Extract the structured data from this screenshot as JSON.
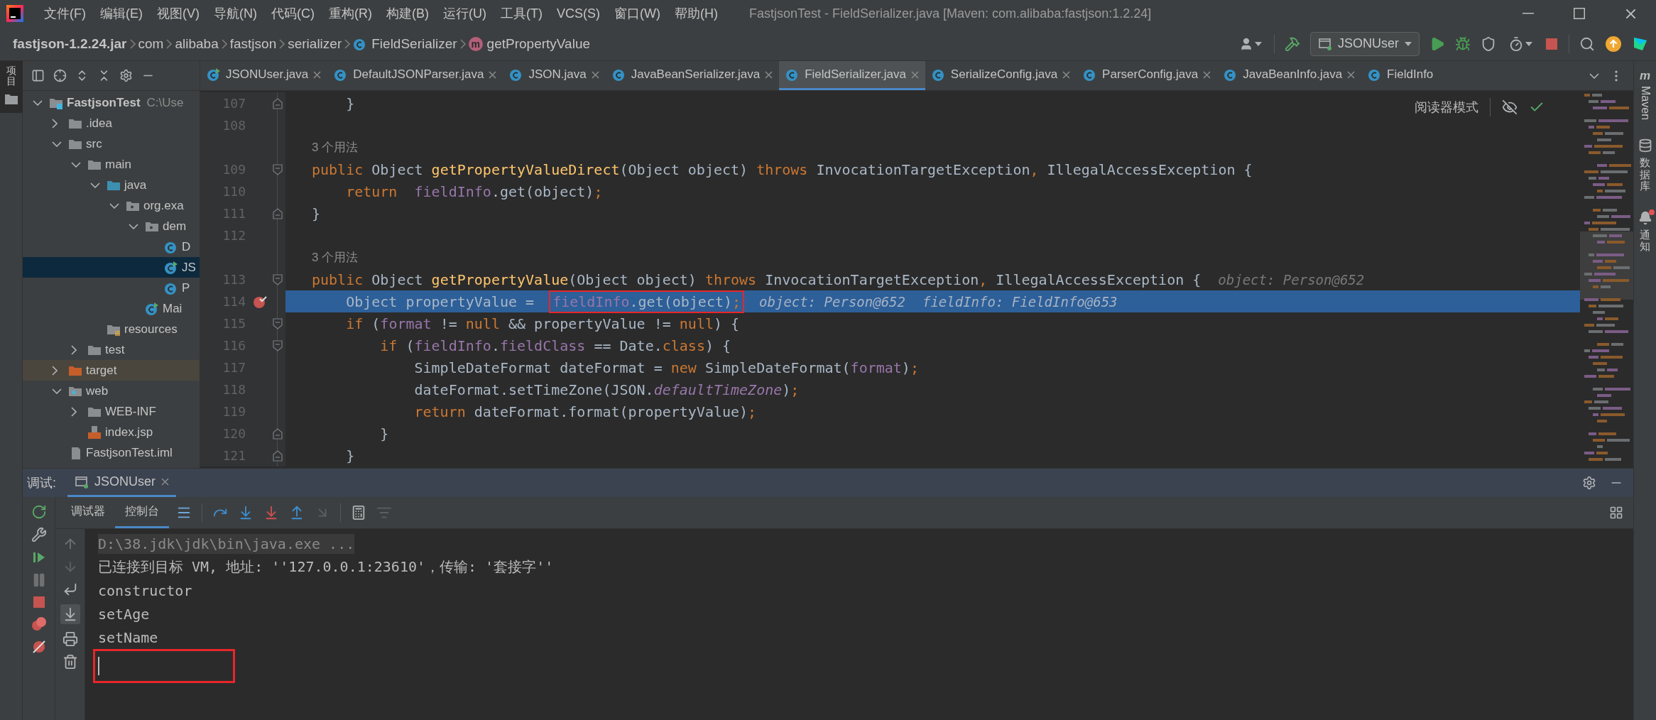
{
  "window": {
    "title": "FastjsonTest - FieldSerializer.java [Maven: com.alibaba:fastjson:1.2.24]"
  },
  "menu": [
    "文件(F)",
    "编辑(E)",
    "视图(V)",
    "导航(N)",
    "代码(C)",
    "重构(R)",
    "构建(B)",
    "运行(U)",
    "工具(T)",
    "VCS(S)",
    "窗口(W)",
    "帮助(H)"
  ],
  "breadcrumbs": [
    {
      "kind": "jar",
      "label": "fastjson-1.2.24.jar"
    },
    {
      "kind": "package",
      "label": "com"
    },
    {
      "kind": "package",
      "label": "alibaba"
    },
    {
      "kind": "package",
      "label": "fastjson"
    },
    {
      "kind": "package",
      "label": "serializer"
    },
    {
      "kind": "class",
      "label": "FieldSerializer"
    },
    {
      "kind": "method",
      "label": "getPropertyValue",
      "badge": "m"
    }
  ],
  "run_config": {
    "label": "JSONUser"
  },
  "left_stripe": [
    {
      "label": "项目",
      "selected": true
    }
  ],
  "project_tree": [
    {
      "label": "FastjsonTest",
      "kind": "module",
      "note": "C:\\Use",
      "expanded": true,
      "selected": false,
      "children": [
        {
          "label": ".idea",
          "kind": "folder",
          "expanded": false,
          "selected": false
        },
        {
          "label": "src",
          "kind": "folder",
          "expanded": true,
          "selected": false,
          "children": [
            {
              "label": "main",
              "kind": "folder",
              "expanded": true,
              "selected": false,
              "children": [
                {
                  "label": "java",
                  "kind": "source-folder",
                  "expanded": true,
                  "selected": false,
                  "children": [
                    {
                      "label": "org.exa",
                      "kind": "package",
                      "expanded": true,
                      "selected": false,
                      "children": [
                        {
                          "label": "dem",
                          "kind": "package",
                          "expanded": true,
                          "selected": false,
                          "children": [
                            {
                              "label": "D",
                              "kind": "class",
                              "selected": false
                            },
                            {
                              "label": "JS",
                              "kind": "class-run",
                              "selected": true
                            },
                            {
                              "label": "P",
                              "kind": "class",
                              "selected": false
                            }
                          ]
                        },
                        {
                          "label": "Mai",
                          "kind": "class-run",
                          "selected": false
                        }
                      ]
                    }
                  ]
                },
                {
                  "label": "resources",
                  "kind": "resources",
                  "selected": false
                }
              ]
            },
            {
              "label": "test",
              "kind": "folder",
              "expanded": false,
              "selected": false
            }
          ]
        },
        {
          "label": "target",
          "kind": "excluded-folder",
          "expanded": false,
          "selected": false
        },
        {
          "label": "web",
          "kind": "web-folder",
          "expanded": true,
          "selected": false,
          "children": [
            {
              "label": "WEB-INF",
              "kind": "folder",
              "expanded": false,
              "selected": false
            },
            {
              "label": "index.jsp",
              "kind": "jsp",
              "selected": false
            }
          ]
        },
        {
          "label": "FastjsonTest.iml",
          "kind": "iml",
          "selected": false
        }
      ]
    }
  ],
  "editor_tabs": [
    {
      "label": "JSONUser.java",
      "kind": "class-run",
      "selected": false,
      "closable": true
    },
    {
      "label": "DefaultJSONParser.java",
      "kind": "class",
      "selected": false,
      "closable": true
    },
    {
      "label": "JSON.java",
      "kind": "class",
      "selected": false,
      "closable": true
    },
    {
      "label": "JavaBeanSerializer.java",
      "kind": "class",
      "selected": false,
      "closable": true
    },
    {
      "label": "FieldSerializer.java",
      "kind": "class",
      "selected": true,
      "closable": true
    },
    {
      "label": "SerializeConfig.java",
      "kind": "class",
      "selected": false,
      "closable": true
    },
    {
      "label": "ParserConfig.java",
      "kind": "class",
      "selected": false,
      "closable": true
    },
    {
      "label": "JavaBeanInfo.java",
      "kind": "class",
      "selected": false,
      "closable": true
    },
    {
      "label": "FieldInfo",
      "kind": "class",
      "selected": false,
      "closable": false
    }
  ],
  "reader_mode": {
    "label": "阅读器模式"
  },
  "code_lines": [
    {
      "kind": "code",
      "number": "107",
      "fold_open": false,
      "fold_close": true,
      "current": false,
      "breakpoint": false,
      "tokens": [
        {
          "kind": "plain",
          "text": "    }"
        }
      ]
    },
    {
      "kind": "code",
      "number": "108",
      "fold_open": false,
      "fold_close": false,
      "current": false,
      "breakpoint": false
    },
    {
      "kind": "usages",
      "text": "3 个用法"
    },
    {
      "kind": "code",
      "number": "109",
      "fold_open": true,
      "fold_close": false,
      "current": false,
      "breakpoint": false,
      "tokens": [
        {
          "kind": "keyword",
          "text": "public "
        },
        {
          "kind": "plain",
          "text": "Object "
        },
        {
          "kind": "method",
          "text": "getPropertyValueDirect"
        },
        {
          "kind": "plain",
          "text": "(Object object) "
        },
        {
          "kind": "keyword",
          "text": "throws "
        },
        {
          "kind": "plain",
          "text": "InvocationTargetException"
        },
        {
          "kind": "keyword",
          "text": ", "
        },
        {
          "kind": "plain",
          "text": "IllegalAccessException {"
        }
      ]
    },
    {
      "kind": "code",
      "number": "110",
      "fold_open": false,
      "fold_close": false,
      "current": false,
      "breakpoint": false,
      "tokens": [
        {
          "kind": "keyword",
          "text": "    return  "
        },
        {
          "kind": "field",
          "text": "fieldInfo"
        },
        {
          "kind": "plain",
          "text": ".get(object)"
        },
        {
          "kind": "keyword",
          "text": ";"
        }
      ]
    },
    {
      "kind": "code",
      "number": "111",
      "fold_open": false,
      "fold_close": true,
      "current": false,
      "breakpoint": false,
      "tokens": [
        {
          "kind": "plain",
          "text": "}"
        }
      ]
    },
    {
      "kind": "code",
      "number": "112",
      "fold_open": false,
      "fold_close": false,
      "current": false,
      "breakpoint": false
    },
    {
      "kind": "usages",
      "text": "3 个用法"
    },
    {
      "kind": "code",
      "number": "113",
      "fold_open": true,
      "fold_close": false,
      "current": false,
      "breakpoint": false,
      "tokens": [
        {
          "kind": "keyword",
          "text": "public "
        },
        {
          "kind": "plain",
          "text": "Object "
        },
        {
          "kind": "method",
          "text": "getPropertyValue"
        },
        {
          "kind": "plain",
          "text": "(Object object) "
        },
        {
          "kind": "keyword",
          "text": "throws "
        },
        {
          "kind": "plain",
          "text": "InvocationTargetException"
        },
        {
          "kind": "keyword",
          "text": ", "
        },
        {
          "kind": "plain",
          "text": "IllegalAccessException {"
        }
      ],
      "hints": [
        "object: Person@652"
      ]
    },
    {
      "kind": "code",
      "number": "114",
      "fold_open": false,
      "fold_close": false,
      "current": true,
      "breakpoint": true,
      "tokens": [
        {
          "kind": "plain",
          "text": "    Object propertyValue =  "
        },
        {
          "kind": "field",
          "text": "fieldInfo",
          "boxed": true
        },
        {
          "kind": "plain",
          "text": ".get(object)",
          "boxed": true
        },
        {
          "kind": "keyword",
          "text": ";",
          "boxed": true
        }
      ],
      "hints": [
        "object: Person@652",
        "fieldInfo: FieldInfo@653"
      ]
    },
    {
      "kind": "code",
      "number": "115",
      "fold_open": true,
      "fold_close": false,
      "current": false,
      "breakpoint": false,
      "tokens": [
        {
          "kind": "keyword",
          "text": "    if "
        },
        {
          "kind": "plain",
          "text": "("
        },
        {
          "kind": "field",
          "text": "format"
        },
        {
          "kind": "plain",
          "text": " != "
        },
        {
          "kind": "keyword",
          "text": "null"
        },
        {
          "kind": "plain",
          "text": " && propertyValue != "
        },
        {
          "kind": "keyword",
          "text": "null"
        },
        {
          "kind": "plain",
          "text": ") {"
        }
      ]
    },
    {
      "kind": "code",
      "number": "116",
      "fold_open": true,
      "fold_close": false,
      "current": false,
      "breakpoint": false,
      "tokens": [
        {
          "kind": "keyword",
          "text": "        if "
        },
        {
          "kind": "plain",
          "text": "("
        },
        {
          "kind": "field",
          "text": "fieldInfo"
        },
        {
          "kind": "plain",
          "text": "."
        },
        {
          "kind": "field",
          "text": "fieldClass"
        },
        {
          "kind": "plain",
          "text": " == Date."
        },
        {
          "kind": "keyword",
          "text": "class"
        },
        {
          "kind": "plain",
          "text": ") {"
        }
      ]
    },
    {
      "kind": "code",
      "number": "117",
      "fold_open": false,
      "fold_close": false,
      "current": false,
      "breakpoint": false,
      "tokens": [
        {
          "kind": "plain",
          "text": "            SimpleDateFormat dateFormat = "
        },
        {
          "kind": "keyword",
          "text": "new "
        },
        {
          "kind": "plain",
          "text": "SimpleDateFormat("
        },
        {
          "kind": "field",
          "text": "format"
        },
        {
          "kind": "plain",
          "text": ")"
        },
        {
          "kind": "keyword",
          "text": ";"
        }
      ]
    },
    {
      "kind": "code",
      "number": "118",
      "fold_open": false,
      "fold_close": false,
      "current": false,
      "breakpoint": false,
      "tokens": [
        {
          "kind": "plain",
          "text": "            dateFormat.setTimeZone(JSON."
        },
        {
          "kind": "static",
          "text": "defaultTimeZone"
        },
        {
          "kind": "plain",
          "text": ")"
        },
        {
          "kind": "keyword",
          "text": ";"
        }
      ]
    },
    {
      "kind": "code",
      "number": "119",
      "fold_open": false,
      "fold_close": false,
      "current": false,
      "breakpoint": false,
      "tokens": [
        {
          "kind": "keyword",
          "text": "            return "
        },
        {
          "kind": "plain",
          "text": "dateFormat.format(propertyValue)"
        },
        {
          "kind": "keyword",
          "text": ";"
        }
      ]
    },
    {
      "kind": "code",
      "number": "120",
      "fold_open": false,
      "fold_close": true,
      "current": false,
      "breakpoint": false,
      "tokens": [
        {
          "kind": "plain",
          "text": "        }"
        }
      ]
    },
    {
      "kind": "code",
      "number": "121",
      "fold_open": false,
      "fold_close": true,
      "current": false,
      "breakpoint": false,
      "tokens": [
        {
          "kind": "plain",
          "text": "    }"
        }
      ]
    }
  ],
  "right_stripe": [
    {
      "kind": "maven",
      "badge": "m",
      "label": "Maven"
    },
    {
      "kind": "database",
      "label": "数据库"
    },
    {
      "kind": "notifications",
      "label": "通知",
      "unread": true
    }
  ],
  "debug_panel": {
    "title": "调试:",
    "tabs": [
      {
        "label": "JSONUser",
        "selected": true
      }
    ],
    "views": [
      {
        "label": "调试器",
        "selected": false
      },
      {
        "label": "控制台",
        "selected": true
      }
    ],
    "scroll_to_end": {
      "on": true
    },
    "console": [
      {
        "kind": "command",
        "text": "D:\\38.jdk\\jdk\\bin\\java.exe ..."
      },
      {
        "kind": "output",
        "text": "已连接到目标 VM, 地址: ''127.0.0.1:23610'，传输: '套接字''"
      },
      {
        "kind": "output",
        "text": "constructor"
      },
      {
        "kind": "output",
        "text": "setAge"
      },
      {
        "kind": "output",
        "text": "setName"
      },
      {
        "kind": "input",
        "boxed": true
      }
    ]
  }
}
